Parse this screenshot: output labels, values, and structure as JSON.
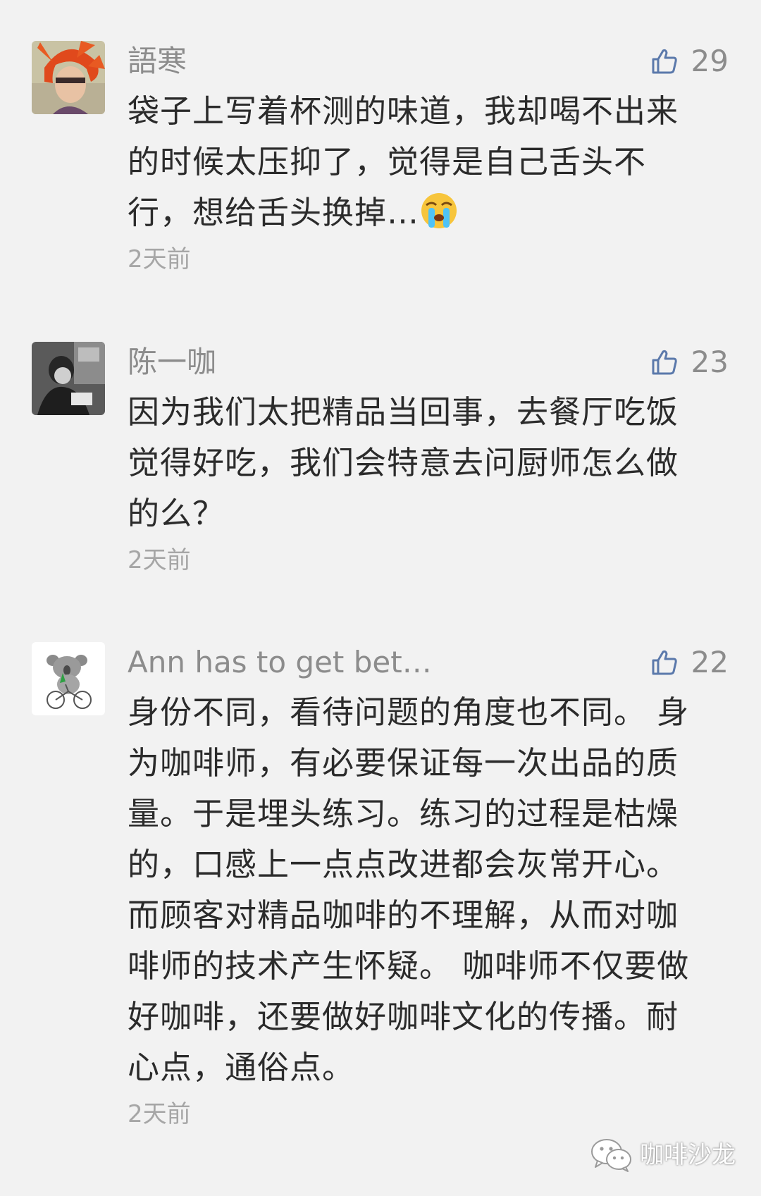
{
  "comments": [
    {
      "author": "語寒",
      "likes": "29",
      "text": "袋子上写着杯测的味道，我却喝不出来\n的时候太压抑了，觉得是自己舌头不\n行，想给舌头换掉…",
      "emoji": "crying-face",
      "time": "2天前",
      "avatar": "avatar-red-hair"
    },
    {
      "author": "陈一咖",
      "likes": "23",
      "text": "因为我们太把精品当回事，去餐厅吃饭\n觉得好吃，我们会特意去问厨师怎么做\n的么？",
      "time": "2天前",
      "avatar": "avatar-bw-photo"
    },
    {
      "author": "Ann has to get bet…",
      "likes": "22",
      "text": "身份不同，看待问题的角度也不同。 身\n为咖啡师，有必要保证每一次出品的质\n量。于是埋头练习。练习的过程是枯燥\n的，口感上一点点改进都会灰常开心。\n而顾客对精品咖啡的不理解，从而对咖\n啡师的技术产生怀疑。 咖啡师不仅要做\n好咖啡，还要做好咖啡文化的传播。耐\n心点，通俗点。",
      "time": "2天前",
      "avatar": "avatar-koala-bike"
    }
  ],
  "watermark": {
    "label": "咖啡沙龙",
    "icon": "wechat-icon"
  },
  "colors": {
    "background": "#f2f2f2",
    "like_icon": "#5b79ab",
    "meta_text": "#8c8c8c",
    "body_text": "#2b2b2b"
  }
}
